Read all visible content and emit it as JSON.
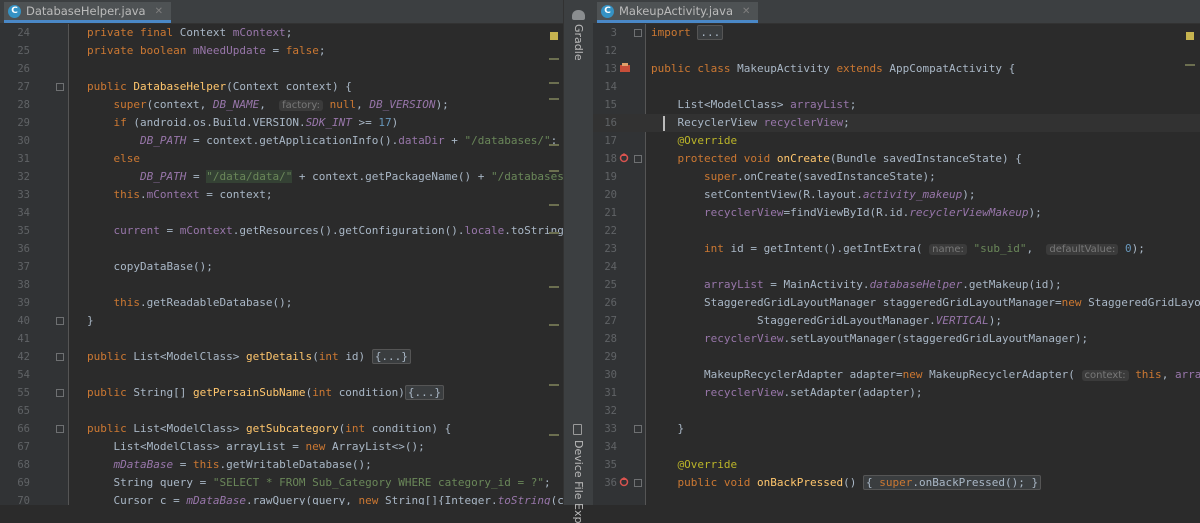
{
  "left": {
    "tab": "DatabaseHelper.java",
    "lines": [
      {
        "n": "24",
        "html": "<span class=\"k\">private final </span>Context <span class=\"c\">mContext</span>;"
      },
      {
        "n": "25",
        "html": "<span class=\"k\">private boolean </span><span class=\"c\">mNeedUpdate </span>= <span class=\"k\">false</span>;"
      },
      {
        "n": "26",
        "html": ""
      },
      {
        "n": "27",
        "html": "<span class=\"k\">public </span><span class=\"f\">DatabaseHelper</span>(Context context) {"
      },
      {
        "n": "28",
        "html": "    <span class=\"k\">super</span>(context, <span class=\"ci\">DB_NAME</span>,  <span class=\"h\">factory:</span> <span class=\"k\">null</span>, <span class=\"ci\">DB_VERSION</span>);"
      },
      {
        "n": "29",
        "html": "    <span class=\"k\">if </span>(android.os.Build.VERSION.<span class=\"ci\">SDK_INT </span>>= <span class=\"n\">17</span>)"
      },
      {
        "n": "30",
        "html": "        <span class=\"ci\">DB_PATH </span>= context.getApplicationInfo().<span class=\"c\">dataDir </span>+ <span class=\"s\">\"/databases/\"</span>;"
      },
      {
        "n": "31",
        "html": "    <span class=\"k\">else</span>"
      },
      {
        "n": "32",
        "html": "        <span class=\"ci\">DB_PATH </span>= <span class=\"s hl\">\"/data/data/\"</span> + context.getPackageName() + <span class=\"s\">\"/databases/\"</span>;"
      },
      {
        "n": "33",
        "html": "    <span class=\"k\">this</span>.<span class=\"c\">mContext </span>= context;"
      },
      {
        "n": "34",
        "html": ""
      },
      {
        "n": "35",
        "html": "    <span class=\"c\">current </span>= <span class=\"c\">mContext</span>.getResources().getConfiguration().<span class=\"c\">locale</span>.toString();"
      },
      {
        "n": "36",
        "html": ""
      },
      {
        "n": "37",
        "html": "    copyDataBase();"
      },
      {
        "n": "38",
        "html": ""
      },
      {
        "n": "39",
        "html": "    <span class=\"k\">this</span>.getReadableDatabase();"
      },
      {
        "n": "40",
        "html": "}"
      },
      {
        "n": "41",
        "html": ""
      },
      {
        "n": "42",
        "html": "<span class=\"k\">public </span>List&lt;ModelClass&gt; <span class=\"f\">getDetails</span>(<span class=\"k\">int </span>id) <span class=\"fb\">{...}</span>"
      },
      {
        "n": "54",
        "html": ""
      },
      {
        "n": "55",
        "html": "<span class=\"k\">public </span>String[] <span class=\"f\">getPersainSubName</span>(<span class=\"k\">int </span>condition)<span class=\"fb\">{...}</span>"
      },
      {
        "n": "65",
        "html": ""
      },
      {
        "n": "66",
        "html": "<span class=\"k\">public </span>List&lt;ModelClass&gt; <span class=\"f\">getSubcategory</span>(<span class=\"k\">int </span>condition) {"
      },
      {
        "n": "67",
        "html": "    List&lt;ModelClass&gt; arrayList = <span class=\"k\">new </span>ArrayList&lt;&gt;();"
      },
      {
        "n": "68",
        "html": "    <span class=\"ci\">mDataBase </span>= <span class=\"k\">this</span>.getWritableDatabase();"
      },
      {
        "n": "69",
        "html": "    String query = <span class=\"s\">\"SELECT * FROM Sub_Category WHERE category_id = ?\"</span>;"
      },
      {
        "n": "70",
        "html": "    Cursor c = <span class=\"ci\">mDataBase</span>.rawQuery(query, <span class=\"k\">new </span>String[]{Integer.<span class=\"ci\">toString</span>(cond"
      }
    ]
  },
  "right": {
    "tab": "MakeupActivity.java",
    "lines": [
      {
        "n": "3",
        "html": "<span class=\"k\">import </span><span class=\"fb\">...</span>"
      },
      {
        "n": "12",
        "html": ""
      },
      {
        "n": "13",
        "html": "<span class=\"k\">public class </span>MakeupActivity <span class=\"k\">extends </span>AppCompatActivity {"
      },
      {
        "n": "14",
        "html": ""
      },
      {
        "n": "15",
        "html": "    List&lt;ModelClass&gt; <span class=\"c\">arrayList</span>;"
      },
      {
        "n": "16",
        "html": "    RecyclerView <span class=\"c\">recyclerView</span>;"
      },
      {
        "n": "17",
        "html": "    <span class=\"a\">@Override</span>"
      },
      {
        "n": "18",
        "html": "    <span class=\"k\">protected void </span><span class=\"f\">onCreate</span>(Bundle savedInstanceState) {"
      },
      {
        "n": "19",
        "html": "        <span class=\"k\">super</span>.onCreate(savedInstanceState);"
      },
      {
        "n": "20",
        "html": "        setContentView(R.layout.<span class=\"ci\">activity_makeup</span>);"
      },
      {
        "n": "21",
        "html": "        <span class=\"c\">recyclerView</span>=findViewById(R.id.<span class=\"ci\">recyclerViewMakeup</span>);"
      },
      {
        "n": "22",
        "html": ""
      },
      {
        "n": "23",
        "html": "        <span class=\"k\">int </span>id = getIntent().getIntExtra( <span class=\"h\">name:</span> <span class=\"s\">\"sub_id\"</span>,  <span class=\"h\">defaultValue:</span> <span class=\"n\">0</span>);"
      },
      {
        "n": "24",
        "html": ""
      },
      {
        "n": "25",
        "html": "        <span class=\"c\">arrayList </span>= MainActivity.<span class=\"ci\">databaseHelper</span>.getMakeup(id);"
      },
      {
        "n": "26",
        "html": "        StaggeredGridLayoutManager staggeredGridLayoutManager=<span class=\"k\">new </span>StaggeredGridLayoutMa"
      },
      {
        "n": "27",
        "html": "                StaggeredGridLayoutManager.<span class=\"ci\">VERTICAL</span>);"
      },
      {
        "n": "28",
        "html": "        <span class=\"c\">recyclerView</span>.setLayoutManager(staggeredGridLayoutManager);"
      },
      {
        "n": "29",
        "html": ""
      },
      {
        "n": "30",
        "html": "        MakeupRecyclerAdapter adapter=<span class=\"k\">new </span>MakeupRecyclerAdapter( <span class=\"h\">context:</span> <span class=\"k\">this</span>, <span class=\"c\">arrayList</span>"
      },
      {
        "n": "31",
        "html": "        <span class=\"c\">recyclerView</span>.setAdapter(adapter);"
      },
      {
        "n": "32",
        "html": ""
      },
      {
        "n": "33",
        "html": "    }"
      },
      {
        "n": "34",
        "html": ""
      },
      {
        "n": "35",
        "html": "    <span class=\"a\">@Override</span>"
      },
      {
        "n": "36",
        "html": "    <span class=\"k\">public void </span><span class=\"f\">onBackPressed</span>() <span class=\"fb\">{ <span class=\"k\">super</span>.onBackPressed(); }</span>"
      }
    ]
  },
  "side_panel": {
    "top": "Gradle",
    "bottom": "Device File Exp"
  },
  "icons": {
    "tab_file": "C",
    "close": "✕"
  }
}
